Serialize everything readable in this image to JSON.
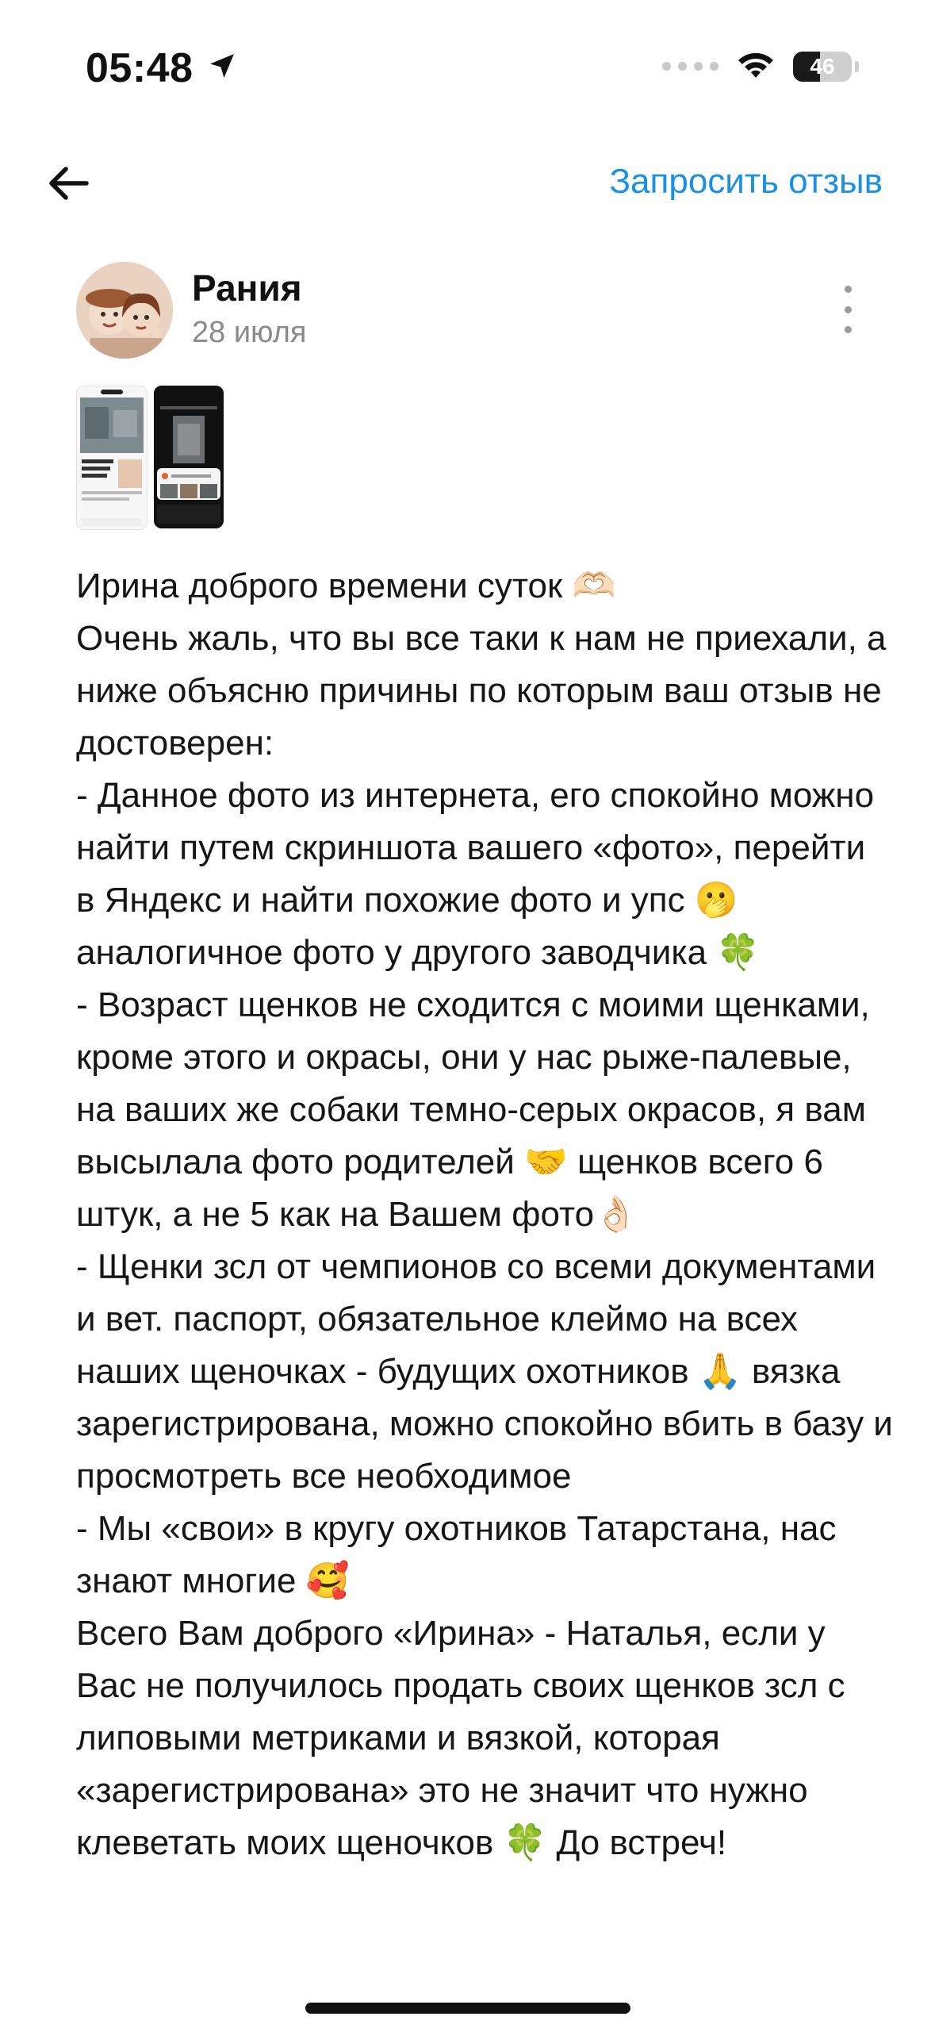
{
  "status_bar": {
    "time": "05:48",
    "battery_level": "46",
    "battery_fraction": 0.46,
    "icons": [
      "location-arrow-icon",
      "signal-dots-icon",
      "wifi-icon",
      "battery-icon"
    ]
  },
  "nav": {
    "back_icon": "arrow-left-icon",
    "request_label": "Запросить отзыв",
    "accent_color": "#1a8fe3"
  },
  "review": {
    "author": "Рания",
    "date": "28 июля",
    "more_icon": "more-vertical-icon",
    "photos": [
      "photo-1",
      "photo-2"
    ],
    "text": "Ирина доброго времени суток 🫶🏻\nОчень жаль, что вы все таки к нам не приехали, а ниже объясню причины по которым ваш отзыв не достоверен:\n- Данное фото из интернета, его спокойно можно найти путем скриншота вашего «фото», перейти в Яндекс и найти похожие фото и упс 🫢 аналогичное фото у другого заводчика 🍀\n- Возраст щенков не сходится с моими щенками, кроме этого и окрасы, они у нас рыже-палевые, на ваших же собаки темно-серых окрасов, я вам высылала фото родителей 🤝 щенков всего 6 штук, а не 5 как на Вашем фото👌🏻\n- Щенки зсл от чемпионов со всеми документами и вет. паспорт, обязательное клеймо на всех наших щеночках - будущих охотников 🙏 вязка зарегистрирована, можно спокойно вбить в базу и просмотреть все необходимое\n- Мы «свои» в кругу охотников Татарстана, нас знают многие 🥰\nВсего Вам доброго «Ирина» - Наталья, если у Вас не получилось продать своих щенков зсл с липовыми метриками и вязкой, которая «зарегистрирована» это не значит что нужно клеветать моих щеночков 🍀 До встреч!"
  }
}
